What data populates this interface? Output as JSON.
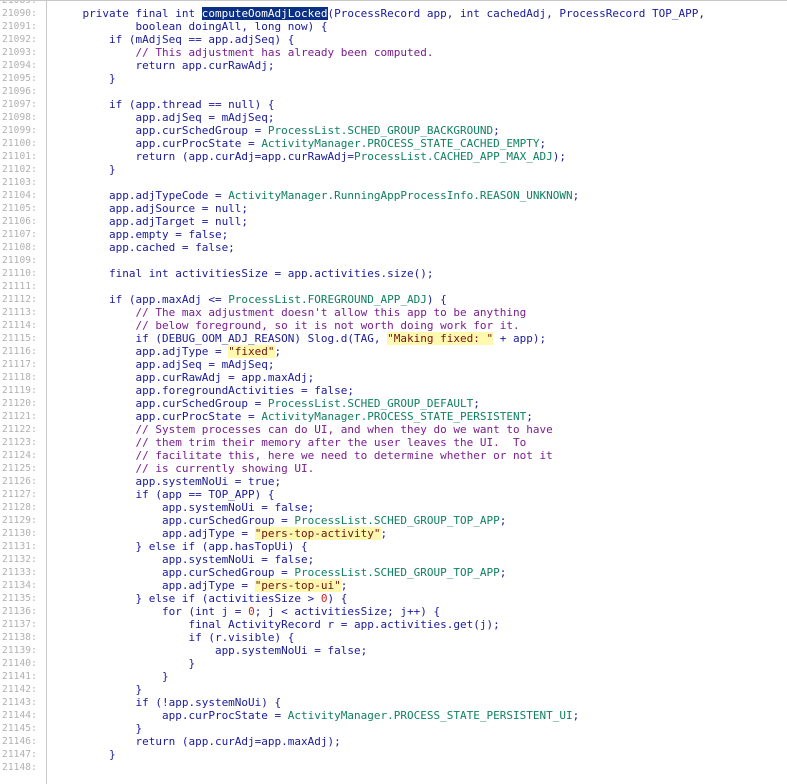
{
  "gutter": {
    "line_numbers": [
      "21089:",
      "21090:",
      "21091:",
      "21092:",
      "21093:",
      "21094:",
      "21095:",
      "21096:",
      "21097:",
      "21098:",
      "21099:",
      "21100:",
      "21101:",
      "21102:",
      "21103:",
      "21104:",
      "21105:",
      "21106:",
      "21107:",
      "21108:",
      "21109:",
      "21110:",
      "21111:",
      "21112:",
      "21113:",
      "21114:",
      "21115:",
      "21116:",
      "21117:",
      "21118:",
      "21119:",
      "21120:",
      "21121:",
      "21122:",
      "21123:",
      "21124:",
      "21125:",
      "21126:",
      "21127:",
      "21128:",
      "21129:",
      "21130:",
      "21131:",
      "21132:",
      "21133:",
      "21134:",
      "21135:",
      "21136:",
      "21137:",
      "21138:",
      "21139:",
      "21140:",
      "21141:",
      "21142:",
      "21143:",
      "21144:",
      "21145:",
      "21146:",
      "21147:",
      "21148:"
    ]
  },
  "code": {
    "lines": [
      [],
      [
        [
          "    private final int ",
          "kw"
        ],
        [
          "computeOomAdjLocked",
          "hl"
        ],
        [
          "(ProcessRecord app, int cachedAdj, ProcessRecord TOP_APP,",
          "kw"
        ]
      ],
      [
        [
          "            boolean doingAll, long now) {",
          "kw"
        ]
      ],
      [
        [
          "        if (mAdjSeq == app.adjSeq) {",
          "kw"
        ]
      ],
      [
        [
          "            // This adjustment has already been computed.",
          "cm"
        ]
      ],
      [
        [
          "            return app.curRawAdj;",
          "kw"
        ]
      ],
      [
        [
          "        }",
          "kw"
        ]
      ],
      [],
      [
        [
          "        if (app.thread == null) {",
          "kw"
        ]
      ],
      [
        [
          "            app.adjSeq = mAdjSeq;",
          "kw"
        ]
      ],
      [
        [
          "            app.curSchedGroup = ",
          "kw"
        ],
        [
          "ProcessList.SCHED_GROUP_BACKGROUND",
          "cs"
        ],
        [
          ";",
          "kw"
        ]
      ],
      [
        [
          "            app.curProcState = ",
          "kw"
        ],
        [
          "ActivityManager.PROCESS_STATE_CACHED_EMPTY",
          "cs"
        ],
        [
          ";",
          "kw"
        ]
      ],
      [
        [
          "            return (app.curAdj=app.curRawAdj=",
          "kw"
        ],
        [
          "ProcessList.CACHED_APP_MAX_ADJ",
          "cs"
        ],
        [
          ");",
          "kw"
        ]
      ],
      [
        [
          "        }",
          "kw"
        ]
      ],
      [],
      [
        [
          "        app.adjTypeCode = ",
          "kw"
        ],
        [
          "ActivityManager.RunningAppProcessInfo.REASON_UNKNOWN",
          "cs"
        ],
        [
          ";",
          "kw"
        ]
      ],
      [
        [
          "        app.adjSource = null;",
          "kw"
        ]
      ],
      [
        [
          "        app.adjTarget = null;",
          "kw"
        ]
      ],
      [
        [
          "        app.empty = false;",
          "kw"
        ]
      ],
      [
        [
          "        app.cached = false;",
          "kw"
        ]
      ],
      [],
      [
        [
          "        final int activitiesSize = app.activities.size();",
          "kw"
        ]
      ],
      [],
      [
        [
          "        if (app.maxAdj <= ",
          "kw"
        ],
        [
          "ProcessList.FOREGROUND_APP_ADJ",
          "cs"
        ],
        [
          ") {",
          "kw"
        ]
      ],
      [
        [
          "            // The max adjustment doesn't allow this app to be anything",
          "cm"
        ]
      ],
      [
        [
          "            // below foreground, so it is not worth doing work for it.",
          "cm"
        ]
      ],
      [
        [
          "            if (DEBUG_OOM_ADJ_REASON) Slog.d(TAG, ",
          "kw"
        ],
        [
          "\"Making fixed: \"",
          "st"
        ],
        [
          " + app);",
          "kw"
        ]
      ],
      [
        [
          "            app.adjType = ",
          "kw"
        ],
        [
          "\"fixed\"",
          "st"
        ],
        [
          ";",
          "kw"
        ]
      ],
      [
        [
          "            app.adjSeq = mAdjSeq;",
          "kw"
        ]
      ],
      [
        [
          "            app.curRawAdj = app.maxAdj;",
          "kw"
        ]
      ],
      [
        [
          "            app.foregroundActivities = false;",
          "kw"
        ]
      ],
      [
        [
          "            app.curSchedGroup = ",
          "kw"
        ],
        [
          "ProcessList.SCHED_GROUP_DEFAULT",
          "cs"
        ],
        [
          ";",
          "kw"
        ]
      ],
      [
        [
          "            app.curProcState = ",
          "kw"
        ],
        [
          "ActivityManager.PROCESS_STATE_PERSISTENT",
          "cs"
        ],
        [
          ";",
          "kw"
        ]
      ],
      [
        [
          "            // System processes can do UI, and when they do we want to have",
          "cm"
        ]
      ],
      [
        [
          "            // them trim their memory after the user leaves the UI.  To",
          "cm"
        ]
      ],
      [
        [
          "            // facilitate this, here we need to determine whether or not it",
          "cm"
        ]
      ],
      [
        [
          "            // is currently showing UI.",
          "cm"
        ]
      ],
      [
        [
          "            app.systemNoUi = true;",
          "kw"
        ]
      ],
      [
        [
          "            if (app == TOP_APP) {",
          "kw"
        ]
      ],
      [
        [
          "                app.systemNoUi = false;",
          "kw"
        ]
      ],
      [
        [
          "                app.curSchedGroup = ",
          "kw"
        ],
        [
          "ProcessList.SCHED_GROUP_TOP_APP",
          "cs"
        ],
        [
          ";",
          "kw"
        ]
      ],
      [
        [
          "                app.adjType = ",
          "kw"
        ],
        [
          "\"pers-top-activity\"",
          "st"
        ],
        [
          ";",
          "kw"
        ]
      ],
      [
        [
          "            } else if (app.hasTopUi) {",
          "kw"
        ]
      ],
      [
        [
          "                app.systemNoUi = false;",
          "kw"
        ]
      ],
      [
        [
          "                app.curSchedGroup = ",
          "kw"
        ],
        [
          "ProcessList.SCHED_GROUP_TOP_APP",
          "cs"
        ],
        [
          ";",
          "kw"
        ]
      ],
      [
        [
          "                app.adjType = ",
          "kw"
        ],
        [
          "\"pers-top-ui\"",
          "st"
        ],
        [
          ";",
          "kw"
        ]
      ],
      [
        [
          "            } else if (activitiesSize > ",
          "kw"
        ],
        [
          "0",
          "nu"
        ],
        [
          ") {",
          "kw"
        ]
      ],
      [
        [
          "                for (int j = ",
          "kw"
        ],
        [
          "0",
          "nu"
        ],
        [
          "; j < activitiesSize; j++) {",
          "kw"
        ]
      ],
      [
        [
          "                    final ActivityRecord r = app.activities.get(j);",
          "kw"
        ]
      ],
      [
        [
          "                    if (r.visible) {",
          "kw"
        ]
      ],
      [
        [
          "                        app.systemNoUi = false;",
          "kw"
        ]
      ],
      [
        [
          "                    }",
          "kw"
        ]
      ],
      [
        [
          "                }",
          "kw"
        ]
      ],
      [
        [
          "            }",
          "kw"
        ]
      ],
      [
        [
          "            if (!app.systemNoUi) {",
          "kw"
        ]
      ],
      [
        [
          "                app.curProcState = ",
          "kw"
        ],
        [
          "ActivityManager.PROCESS_STATE_PERSISTENT_UI",
          "cs"
        ],
        [
          ";",
          "kw"
        ]
      ],
      [
        [
          "            }",
          "kw"
        ]
      ],
      [
        [
          "            return (app.curAdj=app.maxAdj);",
          "kw"
        ]
      ],
      [
        [
          "        }",
          "kw"
        ]
      ],
      []
    ]
  },
  "colors": {
    "gutter_text": "#b0b0b0",
    "keyword": "#1a1a9a",
    "comment": "#7a1e8e",
    "string": "#6e1414",
    "string_bg": "#fff9b0",
    "constant": "#108060",
    "number": "#cc2222",
    "selection_bg": "#0c2f86"
  }
}
